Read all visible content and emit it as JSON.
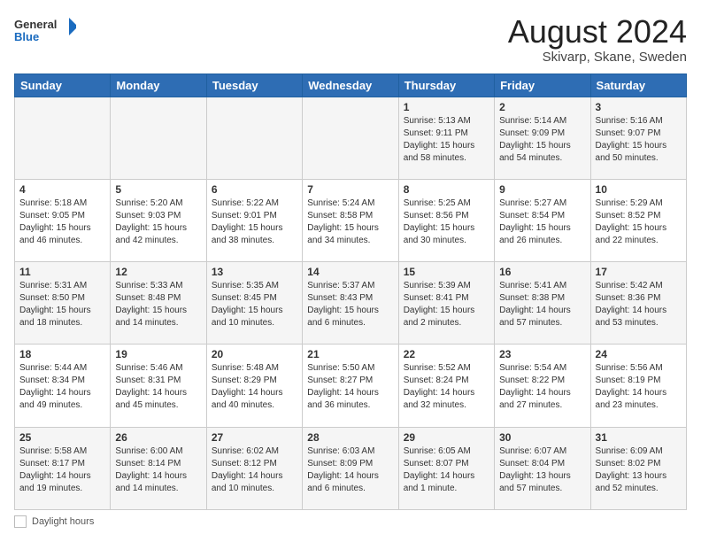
{
  "header": {
    "logo_general": "General",
    "logo_blue": "Blue",
    "month_year": "August 2024",
    "location": "Skivarp, Skane, Sweden"
  },
  "days_of_week": [
    "Sunday",
    "Monday",
    "Tuesday",
    "Wednesday",
    "Thursday",
    "Friday",
    "Saturday"
  ],
  "weeks": [
    [
      {
        "num": "",
        "detail": ""
      },
      {
        "num": "",
        "detail": ""
      },
      {
        "num": "",
        "detail": ""
      },
      {
        "num": "",
        "detail": ""
      },
      {
        "num": "1",
        "detail": "Sunrise: 5:13 AM\nSunset: 9:11 PM\nDaylight: 15 hours\nand 58 minutes."
      },
      {
        "num": "2",
        "detail": "Sunrise: 5:14 AM\nSunset: 9:09 PM\nDaylight: 15 hours\nand 54 minutes."
      },
      {
        "num": "3",
        "detail": "Sunrise: 5:16 AM\nSunset: 9:07 PM\nDaylight: 15 hours\nand 50 minutes."
      }
    ],
    [
      {
        "num": "4",
        "detail": "Sunrise: 5:18 AM\nSunset: 9:05 PM\nDaylight: 15 hours\nand 46 minutes."
      },
      {
        "num": "5",
        "detail": "Sunrise: 5:20 AM\nSunset: 9:03 PM\nDaylight: 15 hours\nand 42 minutes."
      },
      {
        "num": "6",
        "detail": "Sunrise: 5:22 AM\nSunset: 9:01 PM\nDaylight: 15 hours\nand 38 minutes."
      },
      {
        "num": "7",
        "detail": "Sunrise: 5:24 AM\nSunset: 8:58 PM\nDaylight: 15 hours\nand 34 minutes."
      },
      {
        "num": "8",
        "detail": "Sunrise: 5:25 AM\nSunset: 8:56 PM\nDaylight: 15 hours\nand 30 minutes."
      },
      {
        "num": "9",
        "detail": "Sunrise: 5:27 AM\nSunset: 8:54 PM\nDaylight: 15 hours\nand 26 minutes."
      },
      {
        "num": "10",
        "detail": "Sunrise: 5:29 AM\nSunset: 8:52 PM\nDaylight: 15 hours\nand 22 minutes."
      }
    ],
    [
      {
        "num": "11",
        "detail": "Sunrise: 5:31 AM\nSunset: 8:50 PM\nDaylight: 15 hours\nand 18 minutes."
      },
      {
        "num": "12",
        "detail": "Sunrise: 5:33 AM\nSunset: 8:48 PM\nDaylight: 15 hours\nand 14 minutes."
      },
      {
        "num": "13",
        "detail": "Sunrise: 5:35 AM\nSunset: 8:45 PM\nDaylight: 15 hours\nand 10 minutes."
      },
      {
        "num": "14",
        "detail": "Sunrise: 5:37 AM\nSunset: 8:43 PM\nDaylight: 15 hours\nand 6 minutes."
      },
      {
        "num": "15",
        "detail": "Sunrise: 5:39 AM\nSunset: 8:41 PM\nDaylight: 15 hours\nand 2 minutes."
      },
      {
        "num": "16",
        "detail": "Sunrise: 5:41 AM\nSunset: 8:38 PM\nDaylight: 14 hours\nand 57 minutes."
      },
      {
        "num": "17",
        "detail": "Sunrise: 5:42 AM\nSunset: 8:36 PM\nDaylight: 14 hours\nand 53 minutes."
      }
    ],
    [
      {
        "num": "18",
        "detail": "Sunrise: 5:44 AM\nSunset: 8:34 PM\nDaylight: 14 hours\nand 49 minutes."
      },
      {
        "num": "19",
        "detail": "Sunrise: 5:46 AM\nSunset: 8:31 PM\nDaylight: 14 hours\nand 45 minutes."
      },
      {
        "num": "20",
        "detail": "Sunrise: 5:48 AM\nSunset: 8:29 PM\nDaylight: 14 hours\nand 40 minutes."
      },
      {
        "num": "21",
        "detail": "Sunrise: 5:50 AM\nSunset: 8:27 PM\nDaylight: 14 hours\nand 36 minutes."
      },
      {
        "num": "22",
        "detail": "Sunrise: 5:52 AM\nSunset: 8:24 PM\nDaylight: 14 hours\nand 32 minutes."
      },
      {
        "num": "23",
        "detail": "Sunrise: 5:54 AM\nSunset: 8:22 PM\nDaylight: 14 hours\nand 27 minutes."
      },
      {
        "num": "24",
        "detail": "Sunrise: 5:56 AM\nSunset: 8:19 PM\nDaylight: 14 hours\nand 23 minutes."
      }
    ],
    [
      {
        "num": "25",
        "detail": "Sunrise: 5:58 AM\nSunset: 8:17 PM\nDaylight: 14 hours\nand 19 minutes."
      },
      {
        "num": "26",
        "detail": "Sunrise: 6:00 AM\nSunset: 8:14 PM\nDaylight: 14 hours\nand 14 minutes."
      },
      {
        "num": "27",
        "detail": "Sunrise: 6:02 AM\nSunset: 8:12 PM\nDaylight: 14 hours\nand 10 minutes."
      },
      {
        "num": "28",
        "detail": "Sunrise: 6:03 AM\nSunset: 8:09 PM\nDaylight: 14 hours\nand 6 minutes."
      },
      {
        "num": "29",
        "detail": "Sunrise: 6:05 AM\nSunset: 8:07 PM\nDaylight: 14 hours\nand 1 minute."
      },
      {
        "num": "30",
        "detail": "Sunrise: 6:07 AM\nSunset: 8:04 PM\nDaylight: 13 hours\nand 57 minutes."
      },
      {
        "num": "31",
        "detail": "Sunrise: 6:09 AM\nSunset: 8:02 PM\nDaylight: 13 hours\nand 52 minutes."
      }
    ]
  ],
  "footer": {
    "label": "Daylight hours"
  }
}
